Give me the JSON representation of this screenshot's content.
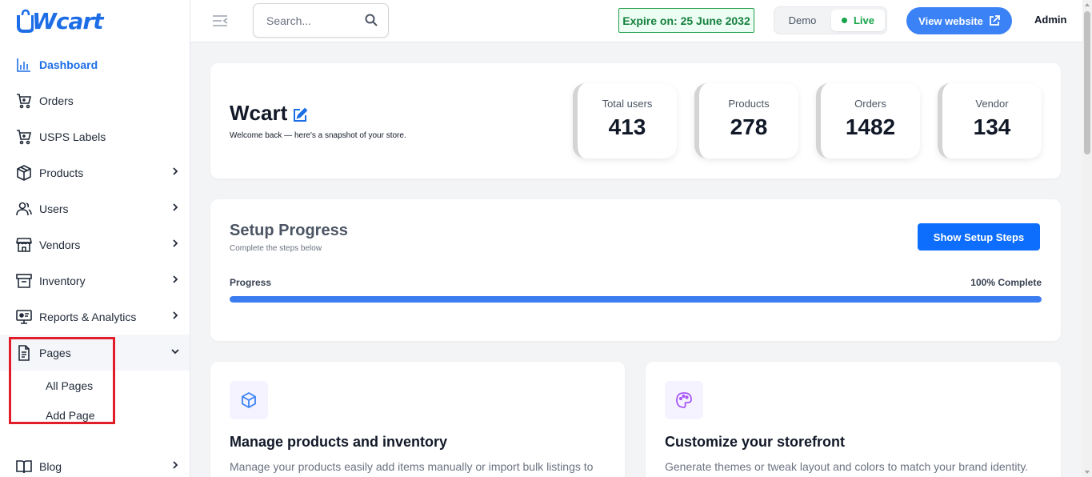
{
  "app": {
    "logo_text": "Wcart"
  },
  "sidebar": {
    "items": [
      {
        "label": "Dashboard",
        "icon": "bar-chart-icon"
      },
      {
        "label": "Orders",
        "icon": "cart-icon"
      },
      {
        "label": "USPS Labels",
        "icon": "cart-icon"
      },
      {
        "label": "Products",
        "icon": "box-icon"
      },
      {
        "label": "Users",
        "icon": "users-icon"
      },
      {
        "label": "Vendors",
        "icon": "store-icon"
      },
      {
        "label": "Inventory",
        "icon": "archive-icon"
      },
      {
        "label": "Reports & Analytics",
        "icon": "monitor-icon"
      },
      {
        "label": "Pages",
        "icon": "file-icon"
      },
      {
        "label": "Blog",
        "icon": "book-icon"
      }
    ],
    "pages_sub": [
      "All Pages",
      "Add Page"
    ]
  },
  "topbar": {
    "search_placeholder": "Search...",
    "expire_text": "Expire on: 25 June 2032",
    "mode_demo": "Demo",
    "mode_live": "Live",
    "view_website": "View website",
    "admin": "Admin"
  },
  "hero": {
    "title": "Wcart",
    "subtitle": "Welcome back — here's a snapshot of your store.",
    "stats": [
      {
        "label": "Total users",
        "value": "413"
      },
      {
        "label": "Products",
        "value": "278"
      },
      {
        "label": "Orders",
        "value": "1482"
      },
      {
        "label": "Vendor",
        "value": "134"
      }
    ]
  },
  "setup": {
    "title": "Setup Progress",
    "subtitle": "Complete the steps below",
    "button": "Show Setup Steps",
    "progress_label": "Progress",
    "progress_text": "100% Complete",
    "progress_value": 100
  },
  "features": [
    {
      "title": "Manage products and inventory",
      "text": "Manage your products easily add items manually or import bulk listings to",
      "icon": "cube-icon"
    },
    {
      "title": "Customize your storefront",
      "text": "Generate themes or tweak layout and colors to match your brand identity.",
      "icon": "palette-icon"
    }
  ],
  "colors": {
    "accent": "#1d6ee6",
    "primary_button": "#0d6efd",
    "live": "#16a34a",
    "highlight": "#e11d2a"
  }
}
